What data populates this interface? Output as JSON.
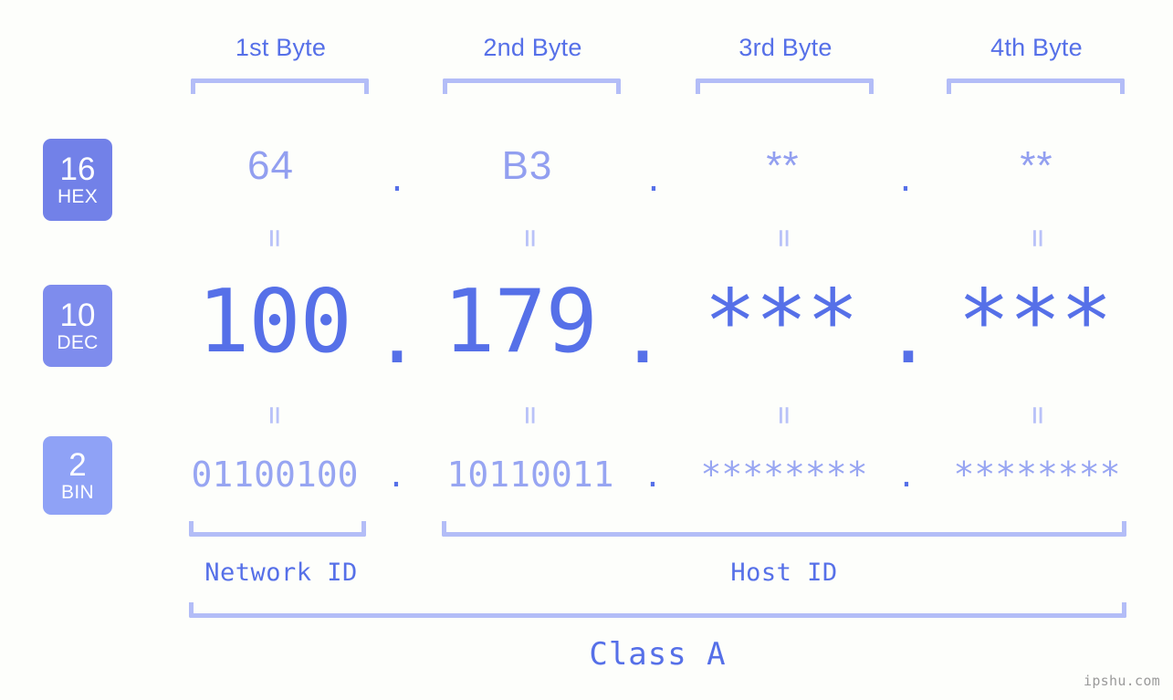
{
  "colors": {
    "background": "#fdfefb",
    "accent_strong": "#5670e8",
    "accent_mid": "#929ff0",
    "accent_light": "#b3bdf7",
    "badge_hex": "#7281e8",
    "badge_dec": "#7e8ced",
    "badge_bin": "#8fa2f6",
    "watermark": "#9a9a9a"
  },
  "byte_headers": [
    {
      "label": "1st Byte"
    },
    {
      "label": "2nd Byte"
    },
    {
      "label": "3rd Byte"
    },
    {
      "label": "4th Byte"
    }
  ],
  "bases": [
    {
      "number": "16",
      "name": "HEX"
    },
    {
      "number": "10",
      "name": "DEC"
    },
    {
      "number": "2",
      "name": "BIN"
    }
  ],
  "rows": {
    "hex": {
      "values": [
        "64",
        "B3",
        "**",
        "**"
      ],
      "separator": "."
    },
    "dec": {
      "values": [
        "100",
        "179",
        "***",
        "***"
      ],
      "separator": "."
    },
    "bin": {
      "values": [
        "01100100",
        "10110011",
        "********",
        "********"
      ],
      "separator": "."
    }
  },
  "equals_symbol": "=",
  "sections": [
    {
      "label": "Network ID"
    },
    {
      "label": "Host ID"
    }
  ],
  "class": {
    "label": "Class A"
  },
  "watermark": {
    "text": "ipshu.com"
  }
}
